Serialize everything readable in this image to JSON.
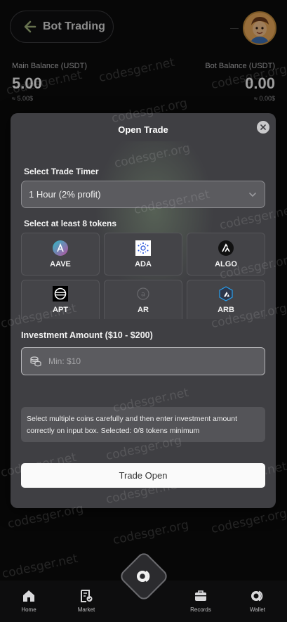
{
  "header": {
    "title": "Bot Trading"
  },
  "balances": {
    "main": {
      "label": "Main Balance (USDT)",
      "value": "5.00",
      "sub": "≈ 5.00$"
    },
    "bot": {
      "label": "Bot Balance (USDT)",
      "value": "0.00",
      "sub": "≈ 0.00$"
    }
  },
  "modal": {
    "title": "Open Trade",
    "timer_label": "Select Trade Timer",
    "timer_value": "1 Hour (2% profit)",
    "tokens_label": "Select at least 8 tokens",
    "tokens": [
      {
        "name": "AAVE",
        "icon": "aave-icon"
      },
      {
        "name": "ADA",
        "icon": "ada-icon"
      },
      {
        "name": "ALGO",
        "icon": "algo-icon"
      },
      {
        "name": "APT",
        "icon": "apt-icon"
      },
      {
        "name": "AR",
        "icon": "ar-icon"
      },
      {
        "name": "ARB",
        "icon": "arb-icon"
      }
    ],
    "investment_label": "Investment Amount ($10 - $200)",
    "investment_placeholder": "Min: $10",
    "notice": "Select multiple coins carefully and then enter investment amount correctly on input box. Selected: 0/8 tokens minimum",
    "trade_button": "Trade Open"
  },
  "nav": {
    "items": [
      {
        "label": "Home",
        "icon": "home-icon"
      },
      {
        "label": "Market",
        "icon": "market-icon"
      },
      {
        "label": "Records",
        "icon": "records-icon"
      },
      {
        "label": "Wallet",
        "icon": "wallet-icon"
      }
    ],
    "center_icon": "bot-trade-icon"
  },
  "watermark": "codesger.net",
  "watermark_alt": "codesger.org",
  "colors": {
    "background": "#0b0b0c",
    "modal": "#3f3f43",
    "input": "#5b5b5f",
    "button": "#fafafa"
  }
}
